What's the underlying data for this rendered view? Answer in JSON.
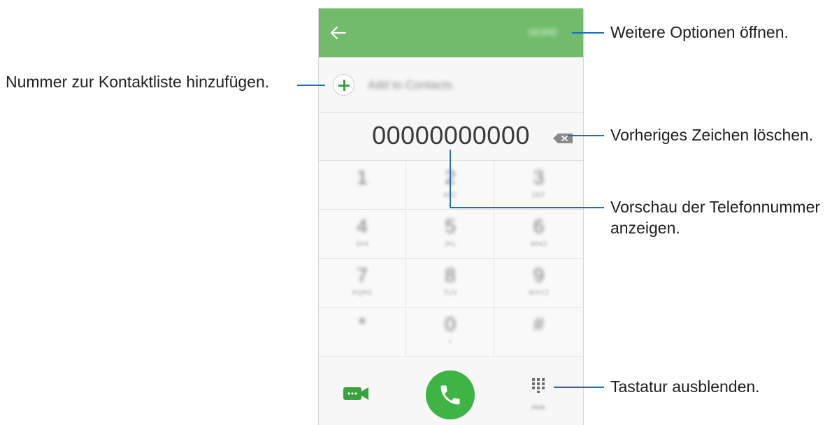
{
  "phone": {
    "topbar": {
      "back_icon": "arrow-left-icon",
      "more_label": "MORE",
      "color": "#72bb6b"
    },
    "add_contact": {
      "icon": "plus-circle-icon",
      "label": "Add to Contacts"
    },
    "number_display": {
      "value": "00000000000",
      "backspace_icon": "backspace-icon"
    },
    "keypad": {
      "keys": [
        {
          "digit": "1",
          "letters": ""
        },
        {
          "digit": "2",
          "letters": "ABC"
        },
        {
          "digit": "3",
          "letters": "DEF"
        },
        {
          "digit": "4",
          "letters": "GHI"
        },
        {
          "digit": "5",
          "letters": "JKL"
        },
        {
          "digit": "6",
          "letters": "MNO"
        },
        {
          "digit": "7",
          "letters": "PQRS"
        },
        {
          "digit": "8",
          "letters": "TUV"
        },
        {
          "digit": "9",
          "letters": "WXYZ"
        },
        {
          "digit": "*",
          "letters": ""
        },
        {
          "digit": "0",
          "letters": "+"
        },
        {
          "digit": "#",
          "letters": ""
        }
      ]
    },
    "bottom": {
      "video_icon": "video-call-icon",
      "call_icon": "phone-icon",
      "keypad_icon": "dialpad-icon",
      "hide_label": "Hide",
      "call_color": "#3db443"
    }
  },
  "annotations": {
    "more_options": "Weitere Optionen öffnen.",
    "add_contact": "Nummer zur Kontaktliste hinzufügen.",
    "delete_char": "Vorheriges Zeichen löschen.",
    "preview_line1": "Vorschau der Telefonnummer",
    "preview_line2": "anzeigen.",
    "hide_keypad": "Tastatur ausblenden."
  }
}
